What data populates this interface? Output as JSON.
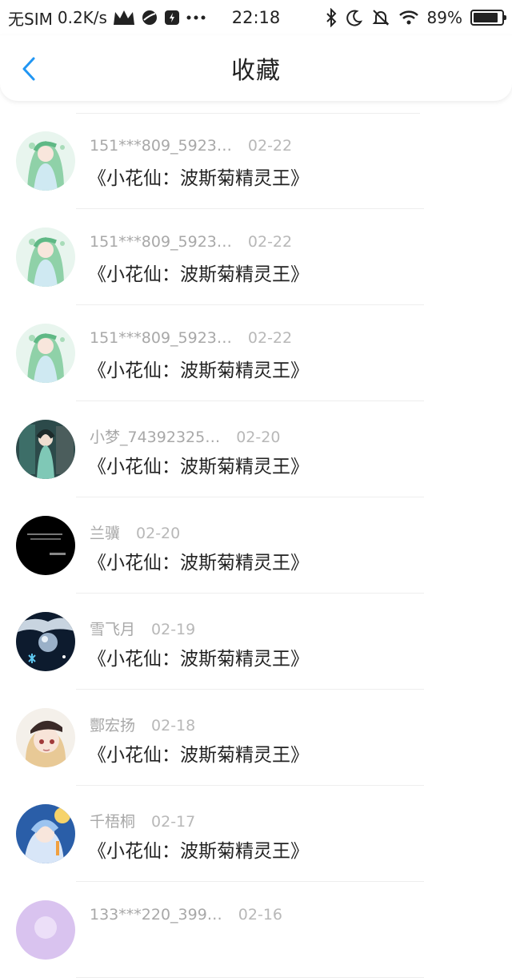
{
  "status_bar": {
    "carrier": "无SIM",
    "speed": "0.2K/s",
    "time": "22:18",
    "battery": "89%",
    "battery_level": 0.89
  },
  "header": {
    "title": "收藏"
  },
  "favorites": [
    {
      "author": "151***809_5923…",
      "date": "02-22",
      "title": "《小花仙：波斯菊精灵王》",
      "avatar": "green-fairy"
    },
    {
      "author": "151***809_5923…",
      "date": "02-22",
      "title": "《小花仙：波斯菊精灵王》",
      "avatar": "green-fairy"
    },
    {
      "author": "151***809_5923…",
      "date": "02-22",
      "title": "《小花仙：波斯菊精灵王》",
      "avatar": "green-fairy"
    },
    {
      "author": "小梦_74392325…",
      "date": "02-20",
      "title": "《小花仙：波斯菊精灵王》",
      "avatar": "teal-collage"
    },
    {
      "author": "兰骥",
      "date": "02-20",
      "title": "《小花仙：波斯菊精灵王》",
      "avatar": "black-text"
    },
    {
      "author": "雪飞月",
      "date": "02-19",
      "title": "《小花仙：波斯菊精灵王》",
      "avatar": "snow-globe"
    },
    {
      "author": "酆宏扬",
      "date": "02-18",
      "title": "《小花仙：波斯菊精灵王》",
      "avatar": "anime-girl"
    },
    {
      "author": "千梧桐",
      "date": "02-17",
      "title": "《小花仙：波斯菊精灵王》",
      "avatar": "blue-anime"
    },
    {
      "author": "133***220_399…",
      "date": "02-16",
      "title": "",
      "avatar": "lavender"
    }
  ]
}
